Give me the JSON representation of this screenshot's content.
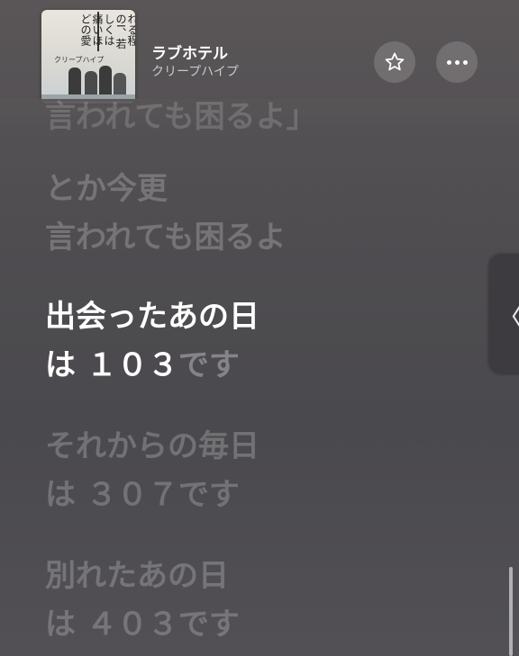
{
  "now_playing": {
    "song_title": "ラブホテル",
    "artist": "クリープハイプ",
    "album_art_text": "吹き零れる程のI、若しくは痛いほどの愛",
    "album_art_band": "クリープハイプ"
  },
  "actions": {
    "favorite_icon": "star-icon",
    "more_icon": "more-icon"
  },
  "lyrics": {
    "lines": [
      "言われても困るよ」",
      "とか今更",
      "言われても困るよ",
      "出会ったあの日",
      "は １０３",
      "です",
      "それからの毎日",
      "は ３０７です",
      "別れたあの日",
      "は ４０３です"
    ]
  },
  "side_panel": {
    "toggle_glyph": "〈"
  }
}
